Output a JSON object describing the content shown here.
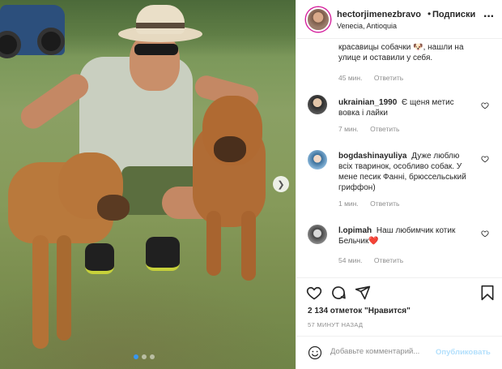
{
  "post": {
    "username": "hectorjimenezbravo",
    "bullet": "•",
    "follow_label": "Подписки",
    "location": "Venecia, Antioquia"
  },
  "comments": [
    {
      "user": "",
      "text": "красавицы собачки 🐶, нашли на улице и оставили у себя.",
      "time": "45 мин.",
      "reply": "Ответить"
    },
    {
      "user": "ukrainian_1990",
      "text": "Є щеня метис вовка і лайки",
      "time": "7 мин.",
      "reply": "Ответить"
    },
    {
      "user": "bogdashinayuliya",
      "text": "Дуже люблю всіх тваринок, особливо собак. У мене песик Фанні, брюссельський гриффон)",
      "time": "1 мин.",
      "reply": "Ответить"
    },
    {
      "user": "l.opimah",
      "text": "Наш любимчик котик Бельчик❤️",
      "time": "54 мин.",
      "reply": "Ответить"
    }
  ],
  "actions": {
    "likes": "2 134 отметок \"Нравится\"",
    "time_ago": "57 МИНУТ НАЗАД"
  },
  "add_comment": {
    "placeholder": "Добавьте комментарий...",
    "publish_label": "Опубликовать"
  },
  "colors": {
    "accent": "#3897f0",
    "publish_disabled": "#b2dffc",
    "heart": "#ed4956"
  },
  "carousel": {
    "active_index": 0,
    "count": 3
  }
}
